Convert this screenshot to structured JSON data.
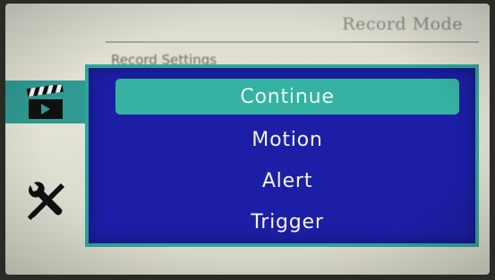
{
  "background": {
    "title": "Record Mode",
    "setting_text": "Record Settings",
    "accent_color": "#2f9a92"
  },
  "sidebar": {
    "items": [
      {
        "icon": "clapperboard-icon",
        "selected": true
      },
      {
        "icon": "tools-icon",
        "selected": false
      }
    ]
  },
  "menu": {
    "background_color": "#1c1fa6",
    "border_color": "#2ea49a",
    "highlight_color": "#35b2a2",
    "selected_index": 0,
    "items": [
      {
        "label": "Continue"
      },
      {
        "label": "Motion"
      },
      {
        "label": "Alert"
      },
      {
        "label": "Trigger"
      }
    ]
  }
}
